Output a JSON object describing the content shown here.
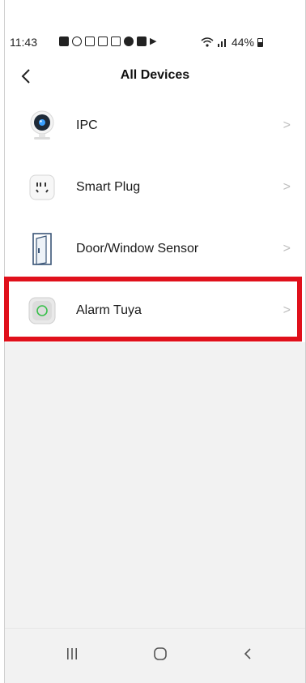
{
  "status_bar": {
    "time": "11:43",
    "battery_text": "44%"
  },
  "header": {
    "back_icon": "chevron-left-icon",
    "title": "All Devices"
  },
  "devices": [
    {
      "label": "IPC",
      "icon": "camera-icon"
    },
    {
      "label": "Smart Plug",
      "icon": "smart-plug-icon"
    },
    {
      "label": "Door/Window Sensor",
      "icon": "door-sensor-icon"
    },
    {
      "label": "Alarm Tuya",
      "icon": "alarm-hub-icon"
    }
  ],
  "highlight_color": "#e0101b",
  "system_nav": [
    "recent-apps-icon",
    "home-icon",
    "back-icon"
  ]
}
